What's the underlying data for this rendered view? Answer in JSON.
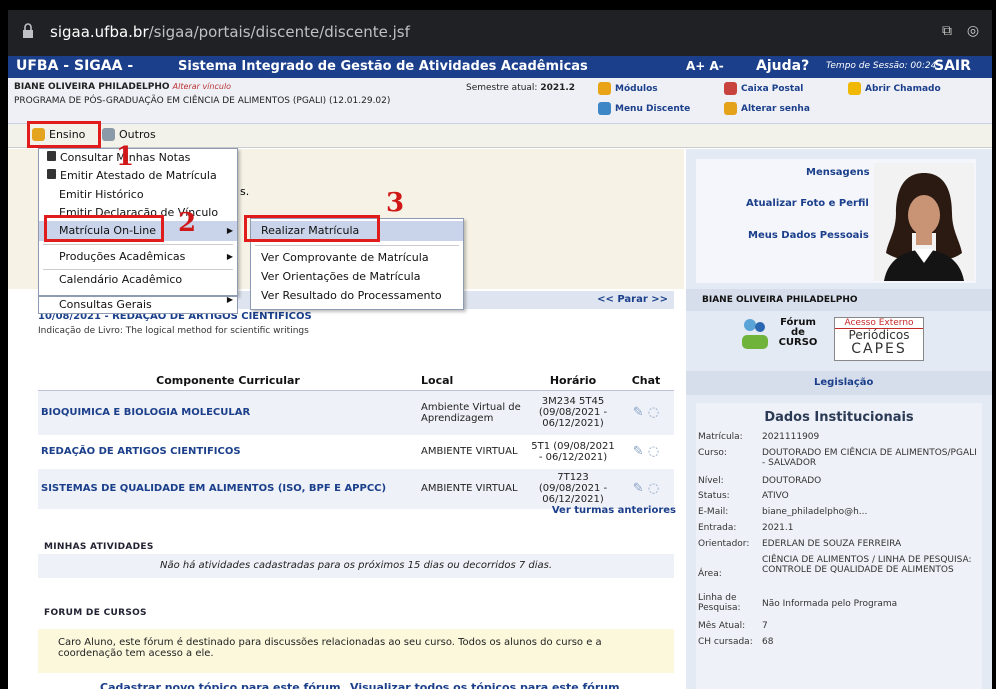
{
  "browser": {
    "url_host": "sigaa.ufba.br",
    "url_pre": "",
    "url_post": "/sigaa/portais/discente/discente.jsf"
  },
  "header": {
    "title": "UFBA - SIGAA -",
    "subtitle": "Sistema Integrado de Gestão de Atividades Acadêmicas",
    "font_controls": "A+ A-",
    "help": "Ajuda?",
    "session": "Tempo de Sessão: 00:24",
    "logout": "SAIR"
  },
  "user": {
    "name": "BIANE OLIVEIRA PHILADELPHO",
    "change_link": "Alterar vínculo",
    "program": "PROGRAMA DE PÓS-GRADUAÇÃO EM CIÊNCIA DE ALIMENTOS (PGALI) (12.01.29.02)",
    "semester_label": "Semestre atual:",
    "semester": "2021.2"
  },
  "toplinks": {
    "modules": "Módulos",
    "inbox": "Caixa Postal",
    "ticket": "Abrir Chamado",
    "menu": "Menu Discente",
    "password": "Alterar senha"
  },
  "mainmenu": {
    "ensino": "Ensino",
    "outros": "Outros"
  },
  "dropdown": {
    "items": [
      "Consultar Minhas Notas",
      "Emitir Atestado de Matrícula",
      "Emitir Histórico",
      "Emitir Declaração de Vínculo",
      "Matrícula On-Line",
      "Produções Acadêmicas",
      "Calendário Acadêmico",
      "Consultas Gerais"
    ]
  },
  "submenu": {
    "items": [
      "Realizar Matrícula",
      "Ver Comprovante de Matrícula",
      "Ver Orientações de Matrícula",
      "Ver Resultado do Processamento"
    ]
  },
  "annotations": [
    "1",
    "2",
    "3"
  ],
  "partial": {
    "s": "s."
  },
  "news": {
    "stop": "<< Parar >>",
    "title": "10/08/2021 - REDAÇÃO DE ARTIGOS CIENTIFICOS",
    "text": "Indicação de Livro: The logical method for scientific writings"
  },
  "table": {
    "headers": [
      "Componente Curricular",
      "Local",
      "Horário",
      "Chat"
    ],
    "rows": [
      {
        "comp": "BIOQUIMICA E BIOLOGIA MOLECULAR",
        "local": "Ambiente Virtual de Aprendizagem",
        "hor": "3M234 5T45 (09/08/2021 - 06/12/2021)"
      },
      {
        "comp": "REDAÇÃO DE ARTIGOS CIENTIFICOS",
        "local": "AMBIENTE VIRTUAL",
        "hor": "5T1 (09/08/2021 - 06/12/2021)"
      },
      {
        "comp": "SISTEMAS DE QUALIDADE EM ALIMENTOS (ISO, BPF E APPCC)",
        "local": "AMBIENTE VIRTUAL",
        "hor": "7T123 (09/08/2021 - 06/12/2021)"
      }
    ],
    "previous": "Ver turmas anteriores"
  },
  "activities": {
    "title": "Minhas atividades",
    "empty": "Não há atividades cadastradas para os próximos 15 dias ou decorridos 7 dias."
  },
  "forum": {
    "title": "Forum de Cursos",
    "text": "Caro Aluno, este fórum é destinado para discussões relacionadas ao seu curso. Todos os alunos do curso e a coordenação tem acesso a ele.",
    "new_topic": "Cadastrar novo tópico para este fórum",
    "view_all": "Visualizar todos os tópicos para este fórum"
  },
  "side": {
    "messages": "Mensagens",
    "update_photo": "Atualizar Foto e Perfil",
    "personal": "Meus Dados Pessoais",
    "name": "BIANE OLIVEIRA PHILADELPHO",
    "forum_logo": "Fórum de CURSO",
    "capes_top": "Acesso Externo",
    "capes_mid": "Periódicos",
    "capes_bottom": "CAPES",
    "legislation": "Legislação",
    "inst_title": "Dados Institucionais"
  },
  "inst": [
    {
      "k": "Matrícula:",
      "v": "2021111909"
    },
    {
      "k": "Curso:",
      "v": "DOUTORADO EM CIÊNCIA DE ALIMENTOS/PGALI - SALVADOR"
    },
    {
      "k": "Nível:",
      "v": "DOUTORADO"
    },
    {
      "k": "Status:",
      "v": "ATIVO"
    },
    {
      "k": "E-Mail:",
      "v": "biane_philadelpho@h..."
    },
    {
      "k": "Entrada:",
      "v": "2021.1"
    },
    {
      "k": "Orientador:",
      "v": "EDERLAN DE SOUZA FERREIRA"
    },
    {
      "k": "Área:",
      "v": "CIÊNCIA DE ALIMENTOS / LINHA DE PESQUISA: CONTROLE DE QUALIDADE DE ALIMENTOS"
    },
    {
      "k": "Linha de Pesquisa:",
      "v": "Não Informada pelo Programa"
    },
    {
      "k": "Mês Atual:",
      "v": "7"
    },
    {
      "k": "CH cursada:",
      "v": "68"
    }
  ]
}
